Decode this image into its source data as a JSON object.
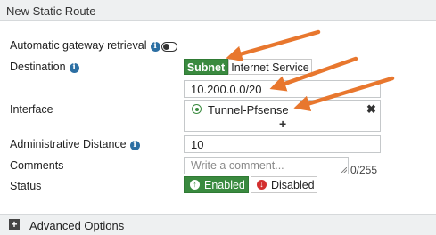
{
  "header": {
    "title": "New Static Route"
  },
  "form": {
    "auto_gateway_label": "Automatic gateway retrieval",
    "destination_label": "Destination",
    "destination_options": [
      "Subnet",
      "Internet Service"
    ],
    "destination_selected": "Subnet",
    "destination_value": "10.200.0.0/20",
    "interface_label": "Interface",
    "interface_value": "Tunnel-Pfsense",
    "interface_add": "+",
    "interface_remove": "✖",
    "admin_distance_label": "Administrative Distance",
    "admin_distance_value": "10",
    "comments_label": "Comments",
    "comments_placeholder": "Write a comment...",
    "comments_counter": "0/255",
    "status_label": "Status",
    "status_enabled": "Enabled",
    "status_disabled": "Disabled",
    "status_selected": "Enabled"
  },
  "advanced": {
    "label": "Advanced Options"
  },
  "icons": {
    "info": "info-icon",
    "toggle": "toggle-off-icon",
    "tunnel": "tunnel-icon",
    "enabled": "arrow-up-icon",
    "disabled": "arrow-down-icon",
    "expand": "plus-square-icon"
  },
  "colors": {
    "accent_green": "#3a8a3f",
    "arrow_orange": "#e8772e",
    "info_blue": "#2c6fa3",
    "disabled_red": "#d32f2f"
  }
}
